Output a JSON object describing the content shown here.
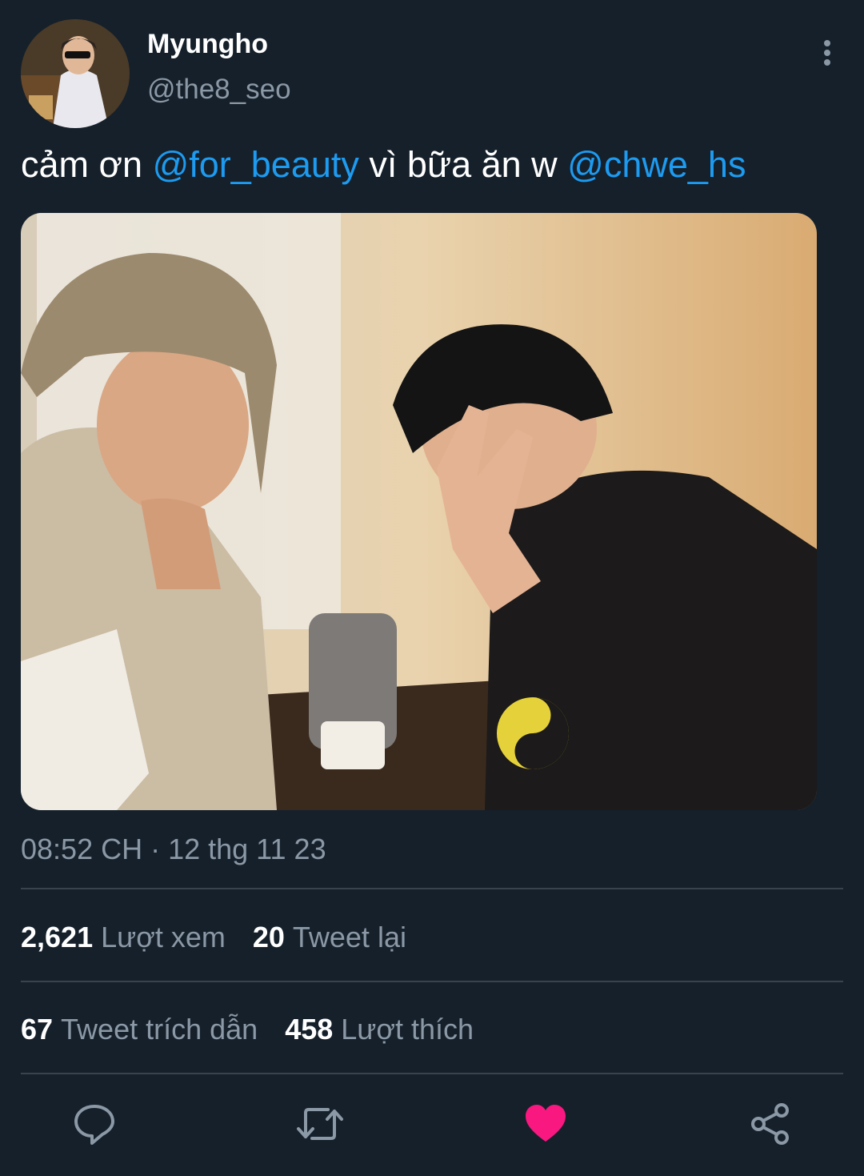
{
  "author": {
    "name": "Myungho",
    "handle": "@the8_seo"
  },
  "tweet": {
    "text_parts": [
      {
        "text": "cảm ơn ",
        "type": "plain"
      },
      {
        "text": "@for_beauty",
        "type": "mention"
      },
      {
        "text": " vì bữa ăn w ",
        "type": "plain"
      },
      {
        "text": "@chwe_hs",
        "type": "mention"
      }
    ],
    "timestamp": "08:52 CH · 12 thg 11 23"
  },
  "stats": {
    "views_count": "2,621",
    "views_label": "Lượt xem",
    "retweets_count": "20",
    "retweets_label": "Tweet lại",
    "quotes_count": "67",
    "quotes_label": "Tweet trích dẫn",
    "likes_count": "458",
    "likes_label": "Lượt thích"
  },
  "actions": {
    "reply_icon": "reply-icon",
    "retweet_icon": "retweet-icon",
    "like_icon": "heart-icon",
    "like_active": true,
    "share_icon": "share-icon"
  },
  "colors": {
    "background": "#15202b",
    "mention": "#1d9bf0",
    "secondary_text": "#8b98a5",
    "like": "#f91880",
    "divider": "#38444d"
  }
}
